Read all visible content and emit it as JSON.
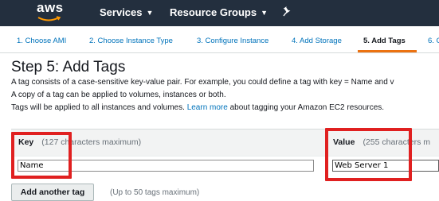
{
  "nav": {
    "logo": "aws",
    "services": "Services",
    "resource_groups": "Resource Groups",
    "pin_icon": "pin-icon"
  },
  "steps": [
    "1. Choose AMI",
    "2. Choose Instance Type",
    "3. Configure Instance",
    "4. Add Storage",
    "5. Add Tags",
    "6. C"
  ],
  "active_step": 4,
  "page": {
    "title": "Step 5: Add Tags",
    "line1": "A tag consists of a case-sensitive key-value pair. For example, you could define a tag with key = Name and v",
    "line2": "A copy of a tag can be applied to volumes, instances or both.",
    "line3_prefix": "Tags will be applied to all instances and volumes. ",
    "learn_more": "Learn more",
    "line3_suffix": " about tagging your Amazon EC2 resources."
  },
  "table": {
    "key_header": "Key",
    "key_hint": "(127 characters maximum)",
    "value_header": "Value",
    "value_hint": "(255 characters m",
    "key_value": "Name",
    "value_value": "Web Server 1"
  },
  "actions": {
    "add_tag": "Add another tag",
    "add_hint": "(Up to 50 tags maximum)"
  },
  "colors": {
    "nav_bg": "#232f3e",
    "link": "#0073bb",
    "active_underline": "#ec7211",
    "highlight": "#e02020"
  }
}
